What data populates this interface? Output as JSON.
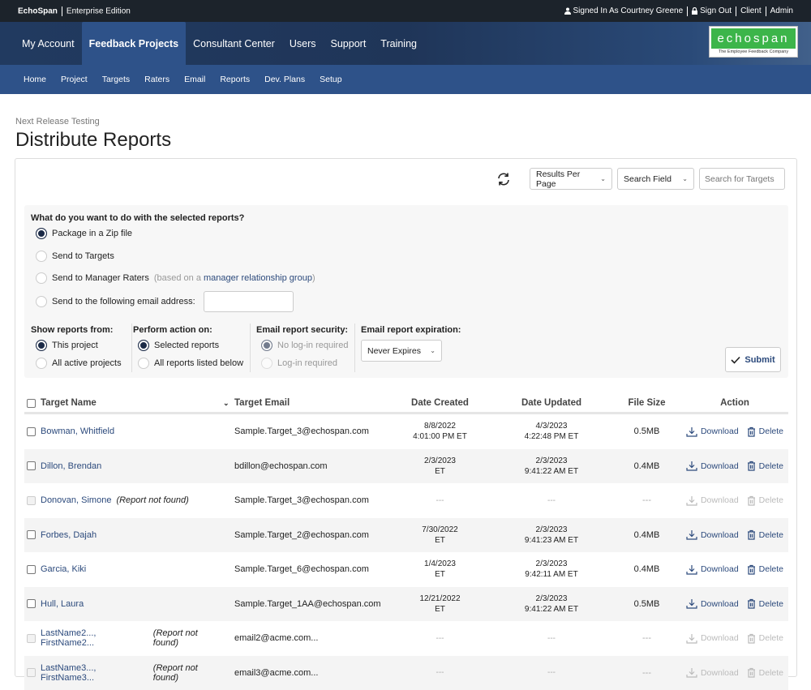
{
  "topbar": {
    "brand": "EchoSpan",
    "edition": "Enterprise Edition",
    "signed_in": "Signed In As Courtney Greene",
    "sign_out": "Sign Out",
    "client": "Client",
    "admin": "Admin"
  },
  "mainnav": {
    "items": [
      "My Account",
      "Feedback Projects",
      "Consultant Center",
      "Users",
      "Support",
      "Training"
    ],
    "active_index": 1
  },
  "logo": {
    "name": "echospan",
    "tagline": "The Employee Feedback Company"
  },
  "subnav": {
    "items": [
      "Home",
      "Project",
      "Targets",
      "Raters",
      "Email",
      "Reports",
      "Dev. Plans",
      "Setup"
    ]
  },
  "page": {
    "breadcrumb": "Next Release Testing",
    "title": "Distribute Reports"
  },
  "toolbar": {
    "results_per_page": "Results Per Page",
    "search_field": "Search Field",
    "search_placeholder": "Search for Targets"
  },
  "options": {
    "question": "What do you want to do with the selected reports?",
    "actions": [
      {
        "label": "Package in a Zip file",
        "selected": true
      },
      {
        "label": "Send to Targets",
        "selected": false
      },
      {
        "label": "Send to Manager Raters",
        "note_prefix": "(based on a ",
        "note_link": "manager relationship group",
        "note_suffix": ")",
        "selected": false
      },
      {
        "label": "Send to the following email address:",
        "selected": false,
        "email_value": ""
      }
    ],
    "show_from": {
      "label": "Show reports from:",
      "options": [
        "This project",
        "All active projects"
      ],
      "selected": 0
    },
    "perform_on": {
      "label": "Perform action on:",
      "options": [
        "Selected reports",
        "All reports listed below"
      ],
      "selected": 0
    },
    "security": {
      "label": "Email report security:",
      "options": [
        "No log-in required",
        "Log-in required"
      ],
      "selected": 0,
      "disabled": true
    },
    "expiration": {
      "label": "Email report expiration:",
      "value": "Never Expires"
    },
    "submit": "Submit"
  },
  "table": {
    "headers": {
      "name": "Target Name",
      "email": "Target Email",
      "created": "Date Created",
      "updated": "Date Updated",
      "size": "File Size",
      "action": "Action"
    },
    "download_label": "Download",
    "delete_label": "Delete",
    "rows": [
      {
        "name": "Bowman, Whitfield",
        "note": "",
        "email": "Sample.Target_3@echospan.com",
        "created1": "8/8/2022",
        "created2": "4:01:00 PM ET",
        "updated1": "4/3/2023",
        "updated2": "4:22:48 PM ET",
        "size": "0.5MB",
        "available": true
      },
      {
        "name": "Dillon, Brendan",
        "note": "",
        "email": "bdillon@echospan.com",
        "created1": "2/3/2023",
        "created2": "ET",
        "updated1": "2/3/2023",
        "updated2": "9:41:22 AM ET",
        "size": "0.4MB",
        "available": true
      },
      {
        "name": "Donovan, Simone",
        "note": "(Report not found)",
        "email": "Sample.Target_3@echospan.com",
        "created1": "---",
        "created2": "",
        "updated1": "---",
        "updated2": "",
        "size": "---",
        "available": false
      },
      {
        "name": "Forbes, Dajah",
        "note": "",
        "email": "Sample.Target_2@echospan.com",
        "created1": "7/30/2022",
        "created2": "ET",
        "updated1": "2/3/2023",
        "updated2": "9:41:23 AM ET",
        "size": "0.4MB",
        "available": true
      },
      {
        "name": "Garcia, Kiki",
        "note": "",
        "email": "Sample.Target_6@echospan.com",
        "created1": "1/4/2023",
        "created2": "ET",
        "updated1": "2/3/2023",
        "updated2": "9:42:11 AM ET",
        "size": "0.4MB",
        "available": true
      },
      {
        "name": "Hull, Laura",
        "note": "",
        "email": "Sample.Target_1AA@echospan.com",
        "created1": "12/21/2022",
        "created2": "ET",
        "updated1": "2/3/2023",
        "updated2": "9:41:22 AM ET",
        "size": "0.5MB",
        "available": true
      },
      {
        "name": "LastName2..., FirstName2...",
        "note": "(Report not found)",
        "email": "email2@acme.com...",
        "created1": "---",
        "created2": "",
        "updated1": "---",
        "updated2": "",
        "size": "---",
        "available": false
      },
      {
        "name": "LastName3..., FirstName3...",
        "note": "(Report not found)",
        "email": "email3@acme.com...",
        "created1": "---",
        "created2": "",
        "updated1": "---",
        "updated2": "",
        "size": "---",
        "available": false
      }
    ]
  },
  "colors": {
    "topbar": "#1c232b",
    "nav": "#213a60",
    "subnav": "#2e5289",
    "link": "#2c4a7c",
    "logo_green": "#3cb54a"
  }
}
